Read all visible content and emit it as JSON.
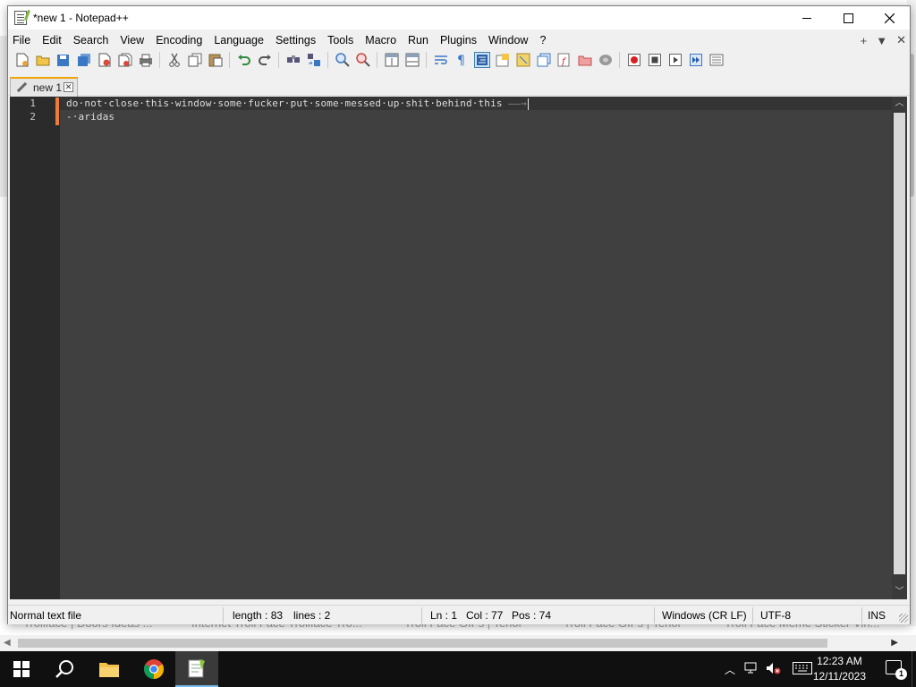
{
  "window": {
    "title": "*new 1 - Notepad++",
    "icon": "notepad-plus-plus-icon"
  },
  "menu": {
    "items": [
      "File",
      "Edit",
      "Search",
      "View",
      "Encoding",
      "Language",
      "Settings",
      "Tools",
      "Macro",
      "Run",
      "Plugins",
      "Window",
      "?"
    ],
    "right_icons": [
      "+",
      "▼",
      "✕"
    ]
  },
  "toolbar": {
    "icons": [
      "new-file-icon",
      "open-file-icon",
      "save-icon",
      "save-all-icon",
      "close-icon",
      "close-all-icon",
      "print-icon",
      "cut-icon",
      "copy-icon",
      "paste-icon",
      "undo-icon",
      "redo-icon",
      "find-icon",
      "replace-icon",
      "zoom-in-icon",
      "zoom-out-icon",
      "sync-vertical-icon",
      "sync-horizontal-icon",
      "word-wrap-icon",
      "show-all-characters-icon",
      "indent-guide-icon",
      "user-defined-language-icon",
      "document-map-icon",
      "document-list-icon",
      "function-list-icon",
      "folder-as-workspace-icon",
      "monitoring-icon",
      "record-macro-icon",
      "stop-recording-icon",
      "playback-macro-icon",
      "run-macro-multiple-icon",
      "save-macro-icon"
    ],
    "selected": "indent-guide-icon"
  },
  "tab": {
    "label": "new 1",
    "close_symbol": "✕"
  },
  "editor": {
    "line_numbers": [
      "1",
      "2"
    ],
    "lines": [
      "do·not·close·this·window·some·fucker·put·some·messed·up·shit·behind·this",
      "-·aridas"
    ],
    "tab_arrow": " ——→"
  },
  "statusbar": {
    "file_type": "Normal text file",
    "length": "length : 83",
    "lines": "lines : 2",
    "ln": "Ln : 1",
    "col": "Col : 77",
    "pos": "Pos : 74",
    "eol": "Windows (CR LF)",
    "encoding": "UTF-8",
    "mode": "INS"
  },
  "background": {
    "tab_titles": [
      "Trollface | Doors Ideas ...",
      "Internet Troll Face Trollface Tro...",
      "Troll Face GIFs | Tenor",
      "Troll Face GIFs | Tenor",
      "Troll Face Meme Sticker Vin..."
    ]
  },
  "taskbar": {
    "apps": [
      "windows-start-icon",
      "search-icon",
      "file-explorer-icon",
      "chrome-icon",
      "notepad-plus-plus-icon"
    ],
    "tray_icons": [
      "show-hidden-icons-icon",
      "network-icon",
      "volume-muted-icon",
      "keyboard-icon"
    ],
    "time": "12:23 AM",
    "date": "12/11/2023",
    "notification_count": "1",
    "accent_color": "#76b9ed"
  }
}
